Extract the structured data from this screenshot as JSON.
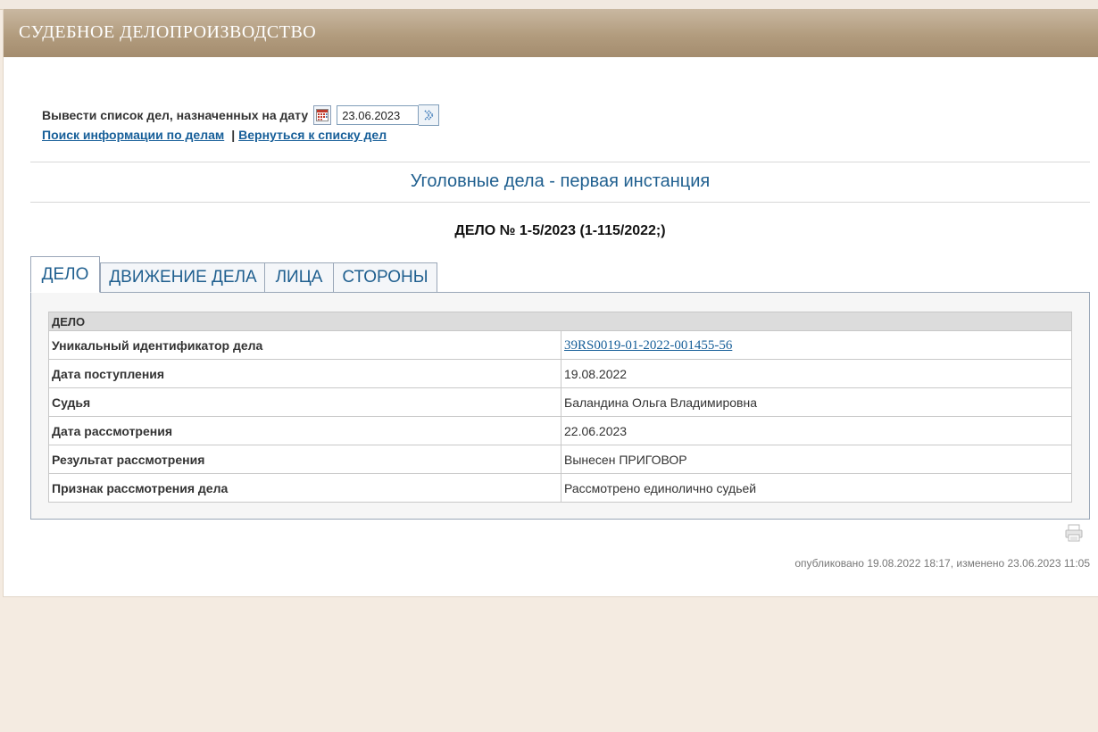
{
  "header": {
    "title": "СУДЕБНОЕ ДЕЛОПРОИЗВОДСТВО"
  },
  "date_filter": {
    "label": "Вывести список дел, назначенных на дату",
    "value": "23.06.2023"
  },
  "links": {
    "search": "Поиск информации по делам",
    "separator": "|",
    "back": "Вернуться к списку дел"
  },
  "section_title": "Уголовные дела - первая инстанция",
  "case_title": "ДЕЛО № 1-5/2023 (1-115/2022;)",
  "tabs": [
    {
      "label": "ДЕЛО",
      "active": true
    },
    {
      "label": "ДВИЖЕНИЕ ДЕЛА",
      "active": false
    },
    {
      "label": "ЛИЦА",
      "active": false
    },
    {
      "label": "СТОРОНЫ",
      "active": false
    }
  ],
  "table": {
    "header": "ДЕЛО",
    "rows": [
      {
        "key": "Уникальный идентификатор дела",
        "value": "39RS0019-01-2022-001455-56"
      },
      {
        "key": "Дата поступления",
        "value": "19.08.2022"
      },
      {
        "key": "Судья",
        "value": "Баландина Ольга Владимировна"
      },
      {
        "key": "Дата рассмотрения",
        "value": "22.06.2023"
      },
      {
        "key": "Результат рассмотрения",
        "value": "Вынесен ПРИГОВОР"
      },
      {
        "key": "Признак рассмотрения дела",
        "value": "Рассмотрено единолично судьей"
      }
    ]
  },
  "published": "опубликовано 19.08.2022 18:17, изменено 23.06.2023 11:05",
  "icons": {
    "calendar": "calendar-icon",
    "go": "go-arrow-icon",
    "print": "printer-icon"
  },
  "colors": {
    "header_bg": "#b29c7e",
    "link": "#175f99",
    "title": "#1f5f8f",
    "page_bg": "#f4ebe1"
  }
}
